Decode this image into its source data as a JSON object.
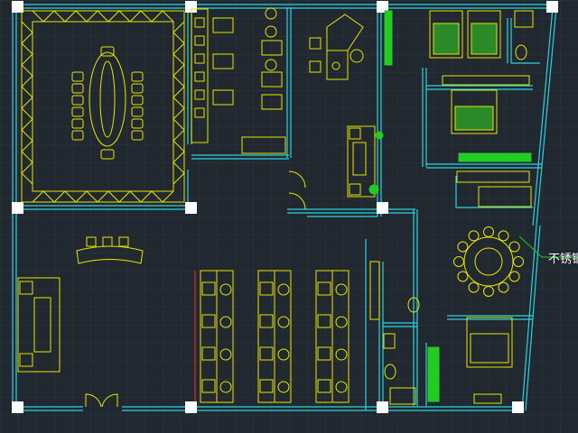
{
  "canvas": {
    "background": "#212830",
    "grid_color": "#2c3540",
    "colors": {
      "wall": "#28d4e0",
      "furniture": "#e6e600",
      "plant": "#22cc22",
      "bed_fill": "#2a8a2a",
      "marker": "#ffffff",
      "text": "#ffffff",
      "accent_red": "#ff3030"
    }
  },
  "annotations": {
    "callout_text": "不锈钢"
  },
  "layers": {
    "walls": "visible",
    "furniture": "visible",
    "annotations": "visible"
  }
}
